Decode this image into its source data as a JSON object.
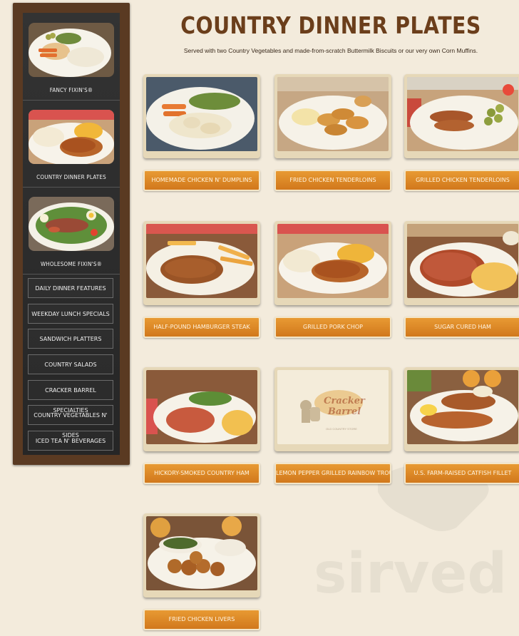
{
  "page": {
    "title": "COUNTRY DINNER PLATES",
    "subtitle": "Served with two Country Vegetables and made-from-scratch Buttermilk Biscuits or our very own Corn Muffins."
  },
  "sidebar": {
    "features": [
      {
        "label": "FANCY FIXIN'S®",
        "photo": "fancy-fixins-photo"
      },
      {
        "label": "COUNTRY DINNER PLATES",
        "photo": "country-dinner-plates-photo"
      },
      {
        "label": "WHOLESOME FIXIN'S®",
        "photo": "wholesome-fixins-photo"
      }
    ],
    "nav": [
      {
        "label": "DAILY DINNER FEATURES"
      },
      {
        "label": "WEEKDAY LUNCH SPECIALS"
      },
      {
        "label": "SANDWICH PLATTERS"
      },
      {
        "label": "COUNTRY SALADS"
      },
      {
        "label": "CRACKER BARREL SPECIALTIES"
      },
      {
        "label": "COUNTRY VEGETABLES N' SIDES"
      },
      {
        "label": "ICED TEA N' BEVERAGES"
      }
    ]
  },
  "dishes": [
    {
      "label": "HOMEMADE CHICKEN N' DUMPLINS"
    },
    {
      "label": "FRIED CHICKEN TENDERLOINS"
    },
    {
      "label": "GRILLED CHICKEN TENDERLOINS"
    },
    {
      "label": "HALF-POUND HAMBURGER STEAK"
    },
    {
      "label": "GRILLED PORK CHOP"
    },
    {
      "label": "SUGAR CURED HAM"
    },
    {
      "label": "HICKORY-SMOKED COUNTRY HAM"
    },
    {
      "label": "LEMON PEPPER GRILLED RAINBOW TROUT"
    },
    {
      "label": "U.S. FARM-RAISED CATFISH FILLET"
    },
    {
      "label": "FRIED CHICKEN LIVERS"
    }
  ],
  "placeholder_logo": {
    "brand": "Cracker Barrel",
    "tagline": "OLD COUNTRY STORE"
  },
  "watermark": "sirved",
  "colors": {
    "background": "#f3ebdc",
    "title": "#6b3e1b",
    "button": "#d9831f",
    "sidebar_frame": "#5a3a22",
    "chalkboard": "#2b2b2b"
  }
}
